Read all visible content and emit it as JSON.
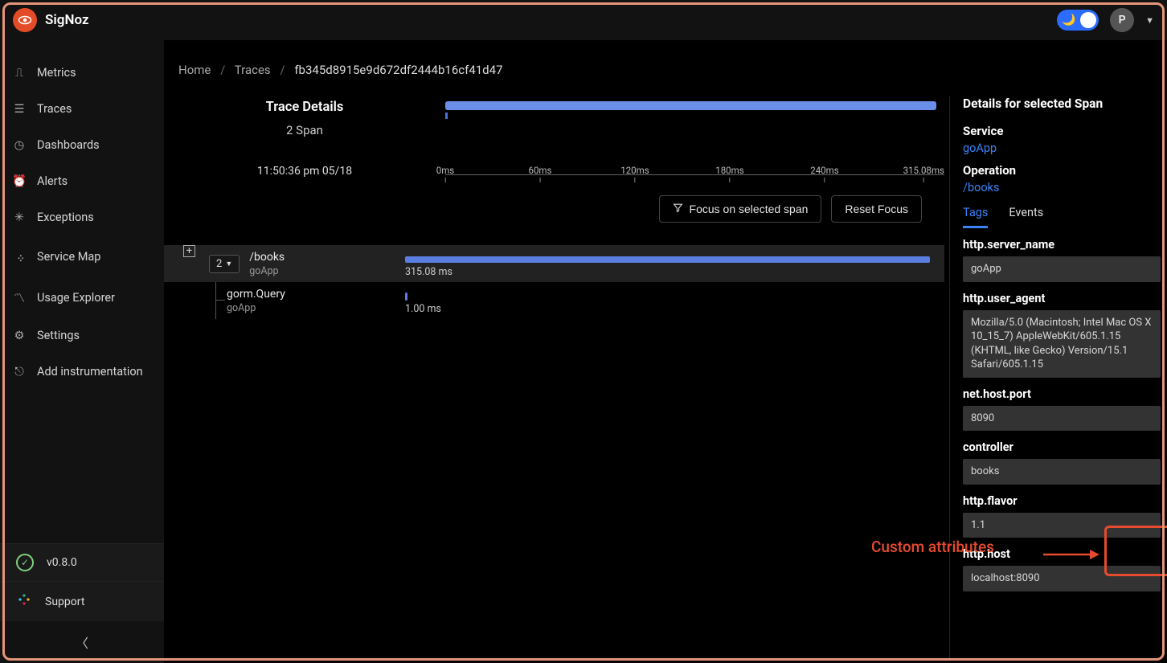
{
  "brand": {
    "name": "SigNoz"
  },
  "topbar": {
    "avatar_initial": "P"
  },
  "sidebar": {
    "items": [
      {
        "label": "Metrics",
        "icon": "bar-chart-icon"
      },
      {
        "label": "Traces",
        "icon": "list-icon"
      },
      {
        "label": "Dashboards",
        "icon": "gauge-icon"
      },
      {
        "label": "Alerts",
        "icon": "alert-icon"
      },
      {
        "label": "Exceptions",
        "icon": "bug-icon"
      },
      {
        "label": "Service Map",
        "icon": "map-icon"
      },
      {
        "label": "Usage Explorer",
        "icon": "trend-icon"
      },
      {
        "label": "Settings",
        "icon": "gear-icon"
      },
      {
        "label": "Add instrumentation",
        "icon": "link-icon"
      }
    ],
    "version": "v0.8.0",
    "support": "Support"
  },
  "breadcrumb": {
    "home": "Home",
    "traces": "Traces",
    "trace_id": "fb345d8915e9d672df2444b16cf41d47"
  },
  "trace": {
    "title": "Trace Details",
    "span_count_text": "2 Span",
    "timestamp": "11:50:36 pm 05/18",
    "ticks": [
      "0ms",
      "60ms",
      "120ms",
      "180ms",
      "240ms",
      "315.08ms"
    ],
    "focus_button": "Focus on selected span",
    "reset_button": "Reset Focus",
    "root_count": "2",
    "spans": [
      {
        "op": "/books",
        "service": "goApp",
        "duration": "315.08 ms"
      },
      {
        "op": "gorm.Query",
        "service": "goApp",
        "duration": "1.00 ms"
      }
    ]
  },
  "details": {
    "title": "Details for selected Span",
    "service_label": "Service",
    "service_value": "goApp",
    "operation_label": "Operation",
    "operation_value": "/books",
    "tabs": {
      "tags": "Tags",
      "events": "Events"
    },
    "tags": [
      {
        "key": "http.server_name",
        "value": "goApp"
      },
      {
        "key": "http.user_agent",
        "value": "Mozilla/5.0 (Macintosh; Intel Mac OS X 10_15_7) AppleWebKit/605.1.15 (KHTML, like Gecko) Version/15.1 Safari/605.1.15"
      },
      {
        "key": "net.host.port",
        "value": "8090"
      },
      {
        "key": "controller",
        "value": "books"
      },
      {
        "key": "http.flavor",
        "value": "1.1"
      },
      {
        "key": "http.host",
        "value": "localhost:8090"
      }
    ]
  },
  "annotation": {
    "label": "Custom attributes"
  }
}
